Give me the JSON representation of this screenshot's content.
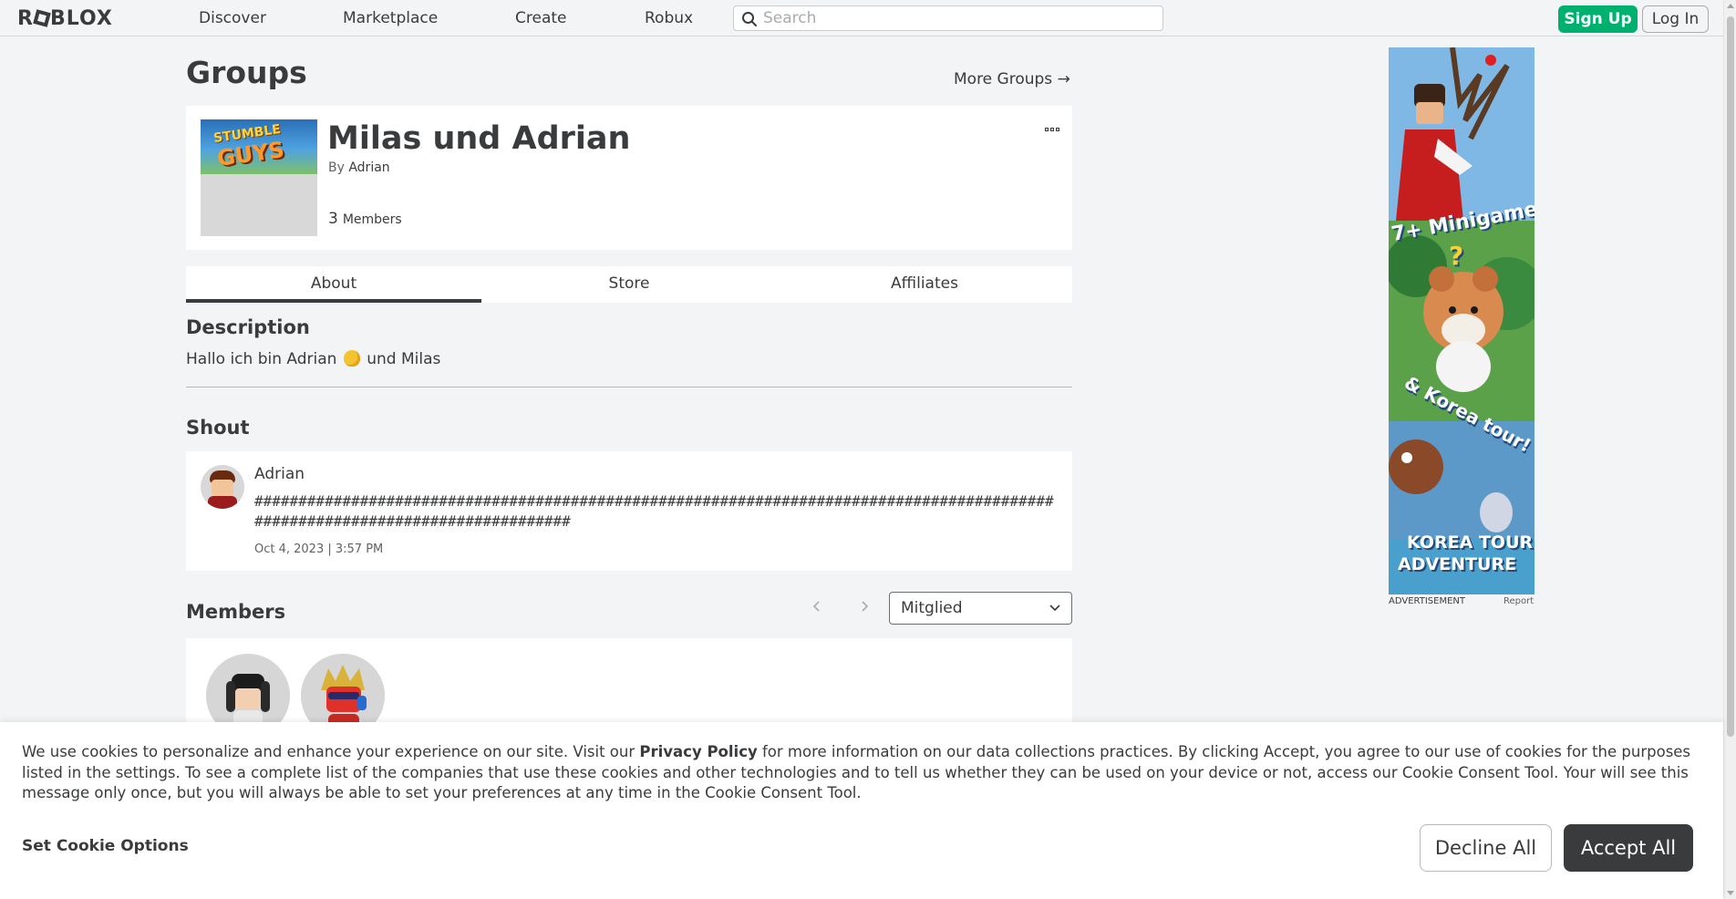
{
  "nav": {
    "logo": "ROBLOX",
    "links": [
      "Discover",
      "Marketplace",
      "Create",
      "Robux"
    ],
    "search_placeholder": "Search",
    "signup_label": "Sign Up",
    "login_label": "Log In"
  },
  "page": {
    "title": "Groups",
    "more_groups": "More Groups →"
  },
  "group": {
    "name": "Milas und Adrian",
    "by_prefix": "By",
    "owner": "Adrian",
    "member_count": "3",
    "members_label": "Members",
    "thumb_text_1": "STUMBLE",
    "thumb_text_2": "GUYS"
  },
  "tabs": [
    "About",
    "Store",
    "Affiliates"
  ],
  "description": {
    "title": "Description",
    "text_before": "Hallo ich bin Adrian",
    "text_after": "und Milas"
  },
  "shout": {
    "title": "Shout",
    "author": "Adrian",
    "text": "###############################################################################################################################",
    "date": "Oct 4, 2023 | 3:57 PM"
  },
  "members": {
    "title": "Members",
    "role_selected": "Mitglied"
  },
  "ad": {
    "text_1": "7+ Minigames",
    "text_2": "?",
    "text_3": "& Korea tour!",
    "text_4": "KOREA TOUR",
    "text_5": "ADVENTURE",
    "label": "ADVERTISEMENT",
    "report": "Report"
  },
  "cookie": {
    "text_1": "We use cookies to personalize and enhance your experience on our site. Visit our ",
    "policy_link": "Privacy Policy",
    "text_2": " for more information on our data collections practices. By clicking Accept, you agree to our use of cookies for the purposes listed in the settings. To see a complete list of the companies that use these cookies and other technologies and to tell us whether they can be used on your device or not, access our Cookie Consent Tool. Your will see this message only once, but you will always be able to set your preferences at any time in the Cookie Consent Tool.",
    "set_options": "Set Cookie Options",
    "decline": "Decline All",
    "accept": "Accept All"
  },
  "colors": {
    "signup_green": "#00b06f",
    "background": "#f2f4f5",
    "text": "#393b3d",
    "accept_dark": "#393b3d"
  }
}
